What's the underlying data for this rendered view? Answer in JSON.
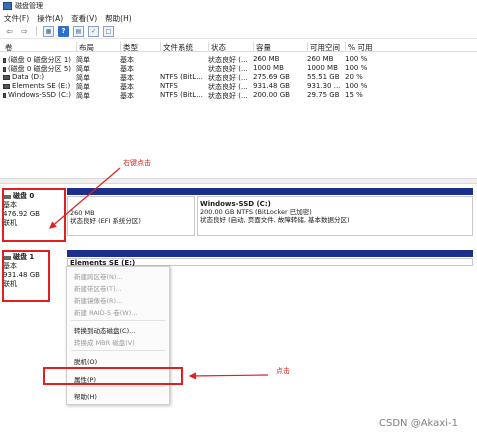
{
  "window": {
    "title": "磁盘管理"
  },
  "menu": [
    "文件(F)",
    "操作(A)",
    "查看(V)",
    "帮助(H)"
  ],
  "toolbar": [
    "back-icon",
    "forward-icon",
    "volume-list-icon",
    "help-icon",
    "properties-icon",
    "check-icon",
    "view-icon"
  ],
  "volume_table": {
    "headers": [
      "卷",
      "布局",
      "类型",
      "文件系统",
      "状态",
      "容量",
      "可用空间",
      "% 可用"
    ],
    "rows": [
      [
        "(磁盘 0 磁盘分区 1)",
        "简单",
        "基本",
        "",
        "状态良好 (...",
        "260 MB",
        "260 MB",
        "100 %"
      ],
      [
        "(磁盘 0 磁盘分区 5)",
        "简单",
        "基本",
        "",
        "状态良好 (...",
        "1000 MB",
        "1000 MB",
        "100 %"
      ],
      [
        "Data (D:)",
        "简单",
        "基本",
        "NTFS (BitL...",
        "状态良好 (...",
        "275.69 GB",
        "55.51 GB",
        "20 %"
      ],
      [
        "Elements SE (E:)",
        "简单",
        "基本",
        "NTFS",
        "状态良好 (...",
        "931.48 GB",
        "931.30 ...",
        "100 %"
      ],
      [
        "Windows-SSD (C:)",
        "简单",
        "基本",
        "NTFS (BitL...",
        "状态良好 (...",
        "200.00 GB",
        "29.75 GB",
        "15 %"
      ]
    ]
  },
  "annotations": {
    "right_click": "右键点击",
    "click": "点击"
  },
  "disk0": {
    "name": "磁盘 0",
    "type": "基本",
    "size": "476.92 GB",
    "status": "联机",
    "partitions": [
      {
        "name": "",
        "line1": "260 MB",
        "line2": "状态良好 (EFI 系统分区)"
      },
      {
        "name": "Windows-SSD  (C:)",
        "line1": "200.00 GB NTFS (BitLocker 已加密)",
        "line2": "状态良好 (启动, 页面文件, 故障转储, 基本数据分区)"
      }
    ]
  },
  "disk1": {
    "name": "磁盘 1",
    "type": "基本",
    "size": "931.48 GB",
    "status": "联机",
    "partition_name": "Elements SE  (E:)"
  },
  "context_menu": {
    "items": [
      {
        "label": "新建跨区卷(N)...",
        "disabled": true
      },
      {
        "label": "新建带区卷(T)...",
        "disabled": true
      },
      {
        "label": "新建镜像卷(R)...",
        "disabled": true
      },
      {
        "label": "新建 RAID-5 卷(W)...",
        "disabled": true
      },
      {
        "label": "转换到动态磁盘(C)...",
        "disabled": false
      },
      {
        "label": "转换成 MBR 磁盘(V)",
        "disabled": true
      },
      {
        "label": "脱机(O)",
        "disabled": false
      },
      {
        "label": "属性(P)",
        "disabled": false
      },
      {
        "label": "帮助(H)",
        "disabled": false
      }
    ]
  },
  "watermark": "CSDN @Akaxi-1",
  "colors": {
    "partition_bar": "#1c2f8c",
    "annotation": "#e02020"
  }
}
